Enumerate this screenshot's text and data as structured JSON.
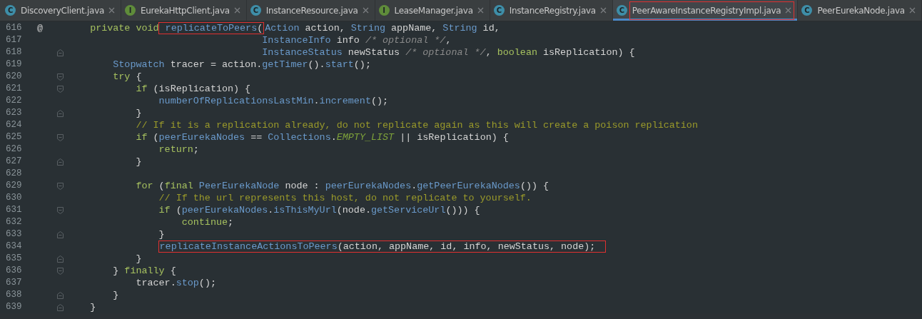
{
  "tabs": [
    {
      "label": "DiscoveryClient.java",
      "kind": "class",
      "badge": "C",
      "selected": false,
      "marked": false
    },
    {
      "label": "EurekaHttpClient.java",
      "kind": "interface",
      "badge": "I",
      "selected": false,
      "marked": false
    },
    {
      "label": "InstanceResource.java",
      "kind": "class",
      "badge": "C",
      "selected": false,
      "marked": false
    },
    {
      "label": "LeaseManager.java",
      "kind": "interface",
      "badge": "I",
      "selected": false,
      "marked": false
    },
    {
      "label": "InstanceRegistry.java",
      "kind": "class",
      "badge": "C",
      "selected": false,
      "marked": false
    },
    {
      "label": "PeerAwareInstanceRegistryImpl.java",
      "kind": "class",
      "badge": "C",
      "selected": true,
      "marked": true
    },
    {
      "label": "PeerEurekaNode.java",
      "kind": "class",
      "badge": "C",
      "selected": false,
      "marked": false
    }
  ],
  "lines": [
    {
      "number": "616",
      "gutter_mark": "@",
      "segments": [
        {
          "marked": false,
          "tokens": [
            {
              "kind": "kw",
              "text": "    private void"
            }
          ]
        },
        {
          "marked": true,
          "tokens": [
            {
              "kind": "fn",
              "text": " replicateToPeers"
            },
            {
              "kind": "plain",
              "text": "("
            }
          ]
        },
        {
          "marked": false,
          "tokens": [
            {
              "kind": "type",
              "text": "Action"
            },
            {
              "kind": "plain",
              "text": " action, "
            },
            {
              "kind": "type",
              "text": "String"
            },
            {
              "kind": "plain",
              "text": " appName, "
            },
            {
              "kind": "type",
              "text": "String"
            },
            {
              "kind": "plain",
              "text": " id,"
            }
          ]
        }
      ]
    },
    {
      "number": "617",
      "segments": [
        {
          "marked": false,
          "tokens": [
            {
              "kind": "type",
              "text": "                                  InstanceInfo"
            },
            {
              "kind": "plain",
              "text": " info "
            },
            {
              "kind": "bc",
              "text": "/* optional */"
            },
            {
              "kind": "plain",
              "text": ","
            }
          ]
        }
      ]
    },
    {
      "number": "618",
      "fold": {
        "kind": "end"
      },
      "segments": [
        {
          "marked": false,
          "tokens": [
            {
              "kind": "type",
              "text": "                                  InstanceStatus"
            },
            {
              "kind": "plain",
              "text": " newStatus "
            },
            {
              "kind": "bc",
              "text": "/* optional */"
            },
            {
              "kind": "plain",
              "text": ", "
            },
            {
              "kind": "kw",
              "text": "boolean"
            },
            {
              "kind": "plain",
              "text": " isReplication) {"
            }
          ]
        }
      ]
    },
    {
      "number": "619",
      "segments": [
        {
          "marked": false,
          "tokens": [
            {
              "kind": "type",
              "text": "        Stopwatch"
            },
            {
              "kind": "plain",
              "text": " tracer = action."
            },
            {
              "kind": "fn",
              "text": "getTimer"
            },
            {
              "kind": "plain",
              "text": "()."
            },
            {
              "kind": "fn",
              "text": "start"
            },
            {
              "kind": "plain",
              "text": "();"
            }
          ]
        }
      ]
    },
    {
      "number": "620",
      "fold": {
        "kind": "start"
      },
      "segments": [
        {
          "marked": false,
          "tokens": [
            {
              "kind": "kw",
              "text": "        try"
            },
            {
              "kind": "plain",
              "text": " {"
            }
          ]
        }
      ]
    },
    {
      "number": "621",
      "fold": {
        "kind": "start"
      },
      "segments": [
        {
          "marked": false,
          "tokens": [
            {
              "kind": "kw",
              "text": "            if"
            },
            {
              "kind": "plain",
              "text": " (isReplication) {"
            }
          ]
        }
      ]
    },
    {
      "number": "622",
      "segments": [
        {
          "marked": false,
          "tokens": [
            {
              "kind": "fn",
              "text": "                numberOfReplicationsLastMin"
            },
            {
              "kind": "plain",
              "text": "."
            },
            {
              "kind": "fn",
              "text": "increment"
            },
            {
              "kind": "plain",
              "text": "();"
            }
          ]
        }
      ]
    },
    {
      "number": "623",
      "fold": {
        "kind": "end"
      },
      "segments": [
        {
          "marked": false,
          "tokens": [
            {
              "kind": "plain",
              "text": "            }"
            }
          ]
        }
      ]
    },
    {
      "number": "624",
      "segments": [
        {
          "marked": false,
          "tokens": [
            {
              "kind": "cm",
              "text": "            // If it is a replication already, do not replicate again as this will create a poison replication"
            }
          ]
        }
      ]
    },
    {
      "number": "625",
      "fold": {
        "kind": "start"
      },
      "segments": [
        {
          "marked": false,
          "tokens": [
            {
              "kind": "kw",
              "text": "            if"
            },
            {
              "kind": "plain",
              "text": " ("
            },
            {
              "kind": "fn",
              "text": "peerEurekaNodes"
            },
            {
              "kind": "plain",
              "text": " == "
            },
            {
              "kind": "type",
              "text": "Collections"
            },
            {
              "kind": "plain",
              "text": "."
            },
            {
              "kind": "const",
              "text": "EMPTY_LIST"
            },
            {
              "kind": "plain",
              "text": " || isReplication) {"
            }
          ]
        }
      ]
    },
    {
      "number": "626",
      "segments": [
        {
          "marked": false,
          "tokens": [
            {
              "kind": "kw",
              "text": "                return"
            },
            {
              "kind": "plain",
              "text": ";"
            }
          ]
        }
      ]
    },
    {
      "number": "627",
      "fold": {
        "kind": "end"
      },
      "segments": [
        {
          "marked": false,
          "tokens": [
            {
              "kind": "plain",
              "text": "            }"
            }
          ]
        }
      ]
    },
    {
      "number": "628"
    },
    {
      "number": "629",
      "fold": {
        "kind": "start"
      },
      "segments": [
        {
          "marked": false,
          "tokens": [
            {
              "kind": "kw",
              "text": "            for"
            },
            {
              "kind": "plain",
              "text": " ("
            },
            {
              "kind": "kw",
              "text": "final"
            },
            {
              "kind": "type",
              "text": " PeerEurekaNode"
            },
            {
              "kind": "plain",
              "text": " node : "
            },
            {
              "kind": "fn",
              "text": "peerEurekaNodes"
            },
            {
              "kind": "plain",
              "text": "."
            },
            {
              "kind": "fn",
              "text": "getPeerEurekaNodes"
            },
            {
              "kind": "plain",
              "text": "()) {"
            }
          ]
        }
      ]
    },
    {
      "number": "630",
      "segments": [
        {
          "marked": false,
          "tokens": [
            {
              "kind": "cm",
              "text": "                // If the url represents this host, do not replicate to yourself."
            }
          ]
        }
      ]
    },
    {
      "number": "631",
      "fold": {
        "kind": "start"
      },
      "segments": [
        {
          "marked": false,
          "tokens": [
            {
              "kind": "kw",
              "text": "                if"
            },
            {
              "kind": "plain",
              "text": " ("
            },
            {
              "kind": "fn",
              "text": "peerEurekaNodes"
            },
            {
              "kind": "plain",
              "text": "."
            },
            {
              "kind": "fn",
              "text": "isThisMyUrl"
            },
            {
              "kind": "plain",
              "text": "(node."
            },
            {
              "kind": "fn",
              "text": "getServiceUrl"
            },
            {
              "kind": "plain",
              "text": "())) {"
            }
          ]
        }
      ]
    },
    {
      "number": "632",
      "segments": [
        {
          "marked": false,
          "tokens": [
            {
              "kind": "kw",
              "text": "                    continue"
            },
            {
              "kind": "plain",
              "text": ";"
            }
          ]
        }
      ]
    },
    {
      "number": "633",
      "fold": {
        "kind": "end"
      },
      "segments": [
        {
          "marked": false,
          "tokens": [
            {
              "kind": "plain",
              "text": "                }"
            }
          ]
        }
      ]
    },
    {
      "number": "634",
      "segments": [
        {
          "marked": true,
          "tokens": [
            {
              "kind": "fn",
              "text": "                replicateInstanceActionsToPeers"
            },
            {
              "kind": "plain",
              "text": "(action, appName, id, info, newStatus, node);"
            }
          ]
        }
      ]
    },
    {
      "number": "635",
      "fold": {
        "kind": "end"
      },
      "segments": [
        {
          "marked": false,
          "tokens": [
            {
              "kind": "plain",
              "text": "            }"
            }
          ]
        }
      ]
    },
    {
      "number": "636",
      "fold": {
        "kind": "start"
      },
      "segments": [
        {
          "marked": false,
          "tokens": [
            {
              "kind": "plain",
              "text": "        } "
            },
            {
              "kind": "kw",
              "text": "finally"
            },
            {
              "kind": "plain",
              "text": " {"
            }
          ]
        }
      ]
    },
    {
      "number": "637",
      "segments": [
        {
          "marked": false,
          "tokens": [
            {
              "kind": "plain",
              "text": "            tracer."
            },
            {
              "kind": "fn",
              "text": "stop"
            },
            {
              "kind": "plain",
              "text": "();"
            }
          ]
        }
      ]
    },
    {
      "number": "638",
      "fold": {
        "kind": "end"
      },
      "segments": [
        {
          "marked": false,
          "tokens": [
            {
              "kind": "plain",
              "text": "        }"
            }
          ]
        }
      ]
    },
    {
      "number": "639",
      "fold": {
        "kind": "end"
      },
      "segments": [
        {
          "marked": false,
          "tokens": [
            {
              "kind": "plain",
              "text": "    }"
            }
          ]
        }
      ]
    }
  ]
}
